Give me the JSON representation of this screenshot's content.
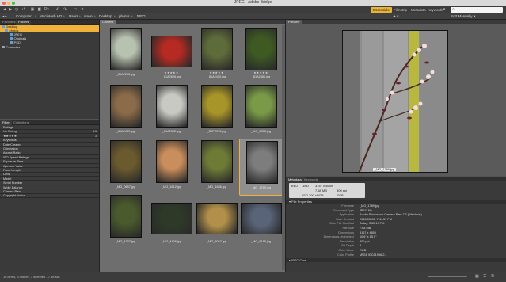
{
  "window": {
    "title": "JPEG - Adobe Bridge"
  },
  "toolbar": {
    "workspaces": [
      "Essentials",
      "Filmstrip",
      "Metadata",
      "Keywords"
    ],
    "active_workspace": "Essentials",
    "search_placeholder": ""
  },
  "path": {
    "crumbs": [
      "Computer",
      "Macintosh HD",
      "Users",
      "steve",
      "Desktop",
      "photos",
      "JPEG"
    ],
    "sort_label": "Sort Manually"
  },
  "favorites": {
    "tabs": [
      "Favorites",
      "Folders"
    ],
    "items": [
      {
        "label": "Desktop",
        "selected": true
      },
      {
        "label": "photos",
        "selected": true
      },
      {
        "label": "JPEG",
        "selected": false
      },
      {
        "label": "Originals",
        "selected": false
      },
      {
        "label": "PSD",
        "selected": false
      },
      {
        "label": "Computer",
        "selected": false
      }
    ]
  },
  "filter": {
    "tabs": [
      "Filter",
      "Collections"
    ],
    "rows": [
      {
        "label": "Ratings",
        "count": "",
        "header": true
      },
      {
        "label": "No Rating",
        "count": "13",
        "header": false
      },
      {
        "label": "★★★★★",
        "count": "3",
        "header": false
      },
      {
        "label": "Keywords",
        "count": "",
        "header": true
      },
      {
        "label": "Date Created",
        "count": "",
        "header": true
      },
      {
        "label": "Orientation",
        "count": "",
        "header": true
      },
      {
        "label": "Aspect Ratio",
        "count": "",
        "header": true
      },
      {
        "label": "ISO Speed Ratings",
        "count": "",
        "header": true
      },
      {
        "label": "Exposure Time",
        "count": "",
        "header": true
      },
      {
        "label": "Aperture Value",
        "count": "",
        "header": true
      },
      {
        "label": "Focal Length",
        "count": "",
        "header": true
      },
      {
        "label": "Lens",
        "count": "",
        "header": true
      },
      {
        "label": "Model",
        "count": "",
        "header": true
      },
      {
        "label": "Serial Number",
        "count": "",
        "header": true
      },
      {
        "label": "White Balance",
        "count": "",
        "header": true
      },
      {
        "label": "Camera Raw",
        "count": "",
        "header": true
      },
      {
        "label": "Copyright Notice",
        "count": "",
        "header": true
      }
    ]
  },
  "content": {
    "tab": "Content",
    "thumbnails": [
      {
        "name": "_81A2266.jpg",
        "stars": "",
        "selected": false,
        "color": "#b8c2b0"
      },
      {
        "name": "_81A2626.jpg",
        "stars": "★★★★★",
        "selected": false,
        "color": "#b52a22"
      },
      {
        "name": "_81A2410.jpg",
        "stars": "★★★★★",
        "selected": false,
        "color": "#5e6b3a"
      },
      {
        "name": "_81A2461.jpg",
        "stars": "★★★★★",
        "selected": false,
        "color": "#3e5a22"
      },
      {
        "name": "_81A2489.jpg",
        "stars": "",
        "selected": false,
        "color": "#8a6b4a"
      },
      {
        "name": "_81A2502.jpg",
        "stars": "",
        "selected": false,
        "color": "#c9c9c4"
      },
      {
        "name": "_D5P2016.jpg",
        "stars": "",
        "selected": false,
        "color": "#a8952a"
      },
      {
        "name": "_MG_0658.jpg",
        "stars": "",
        "selected": false,
        "color": "#7a9a48"
      },
      {
        "name": "_MG_0657.jpg",
        "stars": "",
        "selected": false,
        "color": "#6b5a2e"
      },
      {
        "name": "_MG_1612.jpg",
        "stars": "",
        "selected": false,
        "color": "#c98e5c"
      },
      {
        "name": "_MG_1686.jpg",
        "stars": "",
        "selected": false,
        "color": "#6e7b36"
      },
      {
        "name": "_MG_1789.jpg",
        "stars": "",
        "selected": true,
        "color": "#7d7d7d"
      },
      {
        "name": "_MG_4107.jpg",
        "stars": "",
        "selected": false,
        "color": "#4a5a2c"
      },
      {
        "name": "_MG_4406.jpg",
        "stars": "",
        "selected": false,
        "color": "#2e3a28"
      },
      {
        "name": "_MG_8067.jpg",
        "stars": "",
        "selected": false,
        "color": "#b2904a"
      },
      {
        "name": "_MG_9185.jpg",
        "stars": "",
        "selected": false,
        "color": "#5a6478"
      }
    ]
  },
  "preview": {
    "tab": "Preview",
    "caption": "_MG_1789.jpg"
  },
  "metadata": {
    "tabs": [
      "Metadata",
      "Keywords"
    ],
    "summary": [
      [
        "f/4.0",
        "1/60",
        "3167 x 4659"
      ],
      [
        "",
        "",
        "7.68 MB",
        "300 ppi"
      ],
      [
        "",
        "ISO 200",
        "sRGB",
        "RGB"
      ]
    ],
    "section_title": "File Properties",
    "properties": [
      {
        "key": "Filename",
        "value": "_MG_1789.jpg"
      },
      {
        "key": "Document Type",
        "value": "JPEG file"
      },
      {
        "key": "Application",
        "value": "Adobe Photoshop Camera Raw 7.3 (Windows)"
      },
      {
        "key": "Date Created",
        "value": "2013-03-06, 7:44:59 PM"
      },
      {
        "key": "Date File Modified",
        "value": "Today, 3:52:19 PM"
      },
      {
        "key": "File Size",
        "value": "7.68 MB"
      },
      {
        "key": "Dimensions",
        "value": "3167 x 4659"
      },
      {
        "key": "Dimensions (in inches)",
        "value": "10.6\" x 15.5\""
      },
      {
        "key": "Resolution",
        "value": "300 ppi"
      },
      {
        "key": "Bit Depth",
        "value": "8"
      },
      {
        "key": "Color Mode",
        "value": "RGB"
      },
      {
        "key": "Color Profile",
        "value": "sRGB IEC61966-2.1"
      }
    ],
    "footer_section": "IPTC Core"
  },
  "status": {
    "text": "16 items, 3 hidden, 1 selected - 7.68 MB"
  },
  "colors": {
    "accent": "#f0b23a",
    "panel": "#3a3a3a",
    "content_bg": "#6e6e6e"
  }
}
